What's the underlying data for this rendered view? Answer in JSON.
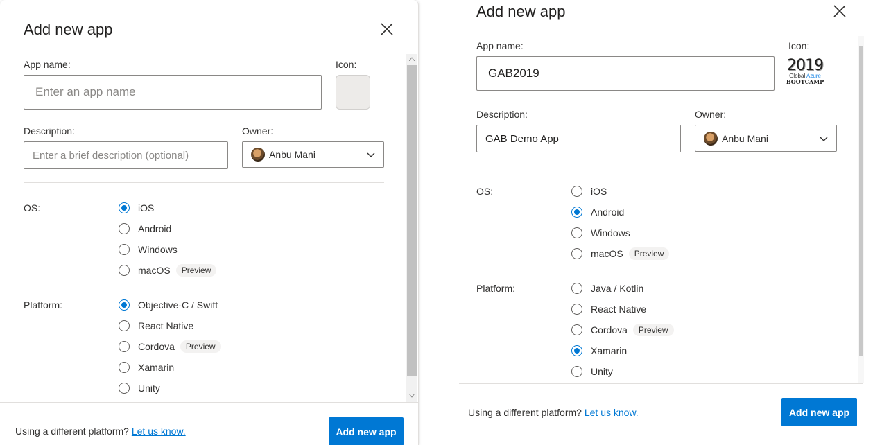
{
  "left": {
    "title": "Add new app",
    "app_name_label": "App name:",
    "app_name_placeholder": "Enter an app name",
    "icon_label": "Icon:",
    "description_label": "Description:",
    "description_placeholder": "Enter a brief description (optional)",
    "owner_label": "Owner:",
    "owner_value": "Anbu Mani",
    "os_label": "OS:",
    "os_options": [
      {
        "label": "iOS",
        "selected": true,
        "badge": ""
      },
      {
        "label": "Android",
        "selected": false,
        "badge": ""
      },
      {
        "label": "Windows",
        "selected": false,
        "badge": ""
      },
      {
        "label": "macOS",
        "selected": false,
        "badge": "Preview"
      }
    ],
    "platform_label": "Platform:",
    "platform_options": [
      {
        "label": "Objective-C / Swift",
        "selected": true,
        "badge": ""
      },
      {
        "label": "React Native",
        "selected": false,
        "badge": ""
      },
      {
        "label": "Cordova",
        "selected": false,
        "badge": "Preview"
      },
      {
        "label": "Xamarin",
        "selected": false,
        "badge": ""
      },
      {
        "label": "Unity",
        "selected": false,
        "badge": ""
      }
    ],
    "footer_text": "Using a different platform?",
    "footer_link": "Let us know.",
    "add_button": "Add new app"
  },
  "right": {
    "title": "Add new app",
    "app_name_label": "App name:",
    "app_name_value": "GAB2019",
    "icon_label": "Icon:",
    "icon_text_year": "2019",
    "icon_text_line1a": "Global",
    "icon_text_line1b": "Azure",
    "icon_text_line2": "BOOTCAMP",
    "description_label": "Description:",
    "description_value": "GAB Demo App",
    "owner_label": "Owner:",
    "owner_value": "Anbu Mani",
    "os_label": "OS:",
    "os_options": [
      {
        "label": "iOS",
        "selected": false,
        "badge": ""
      },
      {
        "label": "Android",
        "selected": true,
        "badge": ""
      },
      {
        "label": "Windows",
        "selected": false,
        "badge": ""
      },
      {
        "label": "macOS",
        "selected": false,
        "badge": "Preview"
      }
    ],
    "platform_label": "Platform:",
    "platform_options": [
      {
        "label": "Java / Kotlin",
        "selected": false,
        "badge": ""
      },
      {
        "label": "React Native",
        "selected": false,
        "badge": ""
      },
      {
        "label": "Cordova",
        "selected": false,
        "badge": "Preview"
      },
      {
        "label": "Xamarin",
        "selected": true,
        "badge": ""
      },
      {
        "label": "Unity",
        "selected": false,
        "badge": ""
      }
    ],
    "footer_text": "Using a different platform?",
    "footer_link": "Let us know.",
    "add_button": "Add new app"
  },
  "colors": {
    "accent": "#0078d4",
    "border": "#8a8886"
  }
}
